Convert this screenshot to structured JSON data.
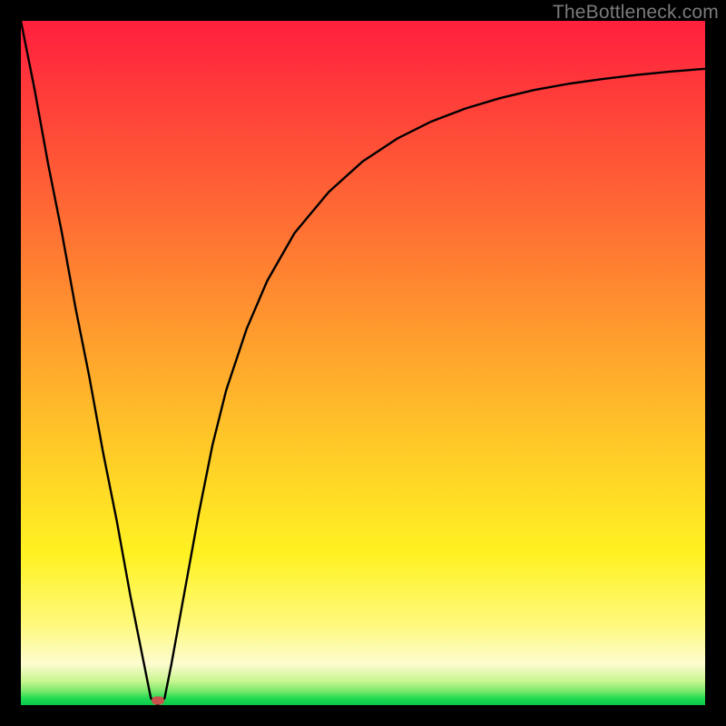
{
  "watermark": "TheBottleneck.com",
  "marker": {
    "x_pct": 20,
    "y_pct": 99.3,
    "color": "#c9534c"
  },
  "chart_data": {
    "type": "line",
    "title": "",
    "xlabel": "",
    "ylabel": "",
    "xlim": [
      0,
      100
    ],
    "ylim": [
      0,
      100
    ],
    "x": [
      0,
      2,
      4,
      6,
      8,
      10,
      12,
      14,
      16,
      18,
      19,
      20,
      21,
      22,
      24,
      26,
      28,
      30,
      33,
      36,
      40,
      45,
      50,
      55,
      60,
      65,
      70,
      75,
      80,
      85,
      90,
      95,
      100
    ],
    "values": [
      100,
      90,
      79,
      69,
      58,
      48,
      37,
      27,
      16,
      6,
      1,
      0,
      1,
      6,
      17,
      28,
      38,
      46,
      55,
      62,
      69,
      75,
      79.5,
      82.8,
      85.3,
      87.2,
      88.7,
      89.9,
      90.8,
      91.5,
      92.1,
      92.6,
      93
    ],
    "annotations": [
      {
        "type": "marker",
        "x": 20,
        "y": 0
      }
    ],
    "background_gradient": [
      "#ff1f3e",
      "#ffc928",
      "#fff222",
      "#21db52"
    ],
    "grid": false,
    "legend": false
  }
}
